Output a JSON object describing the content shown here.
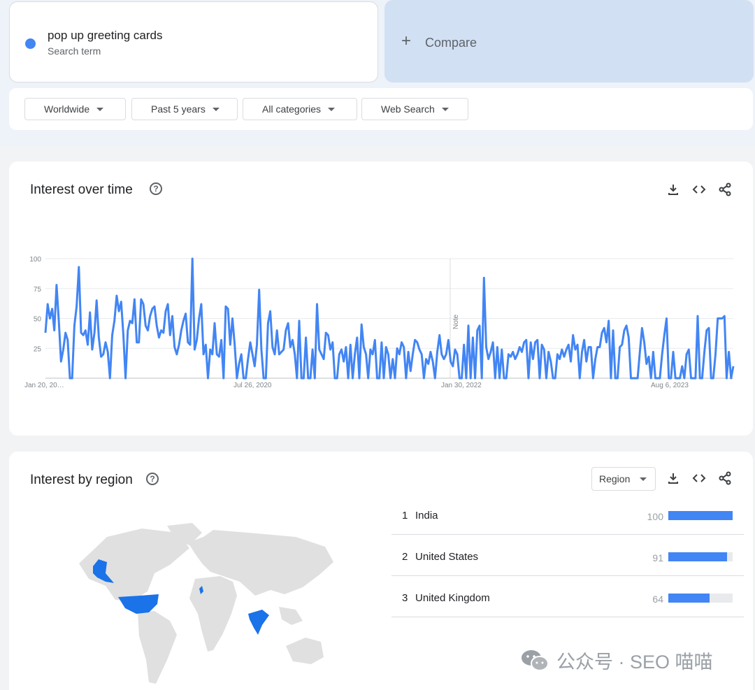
{
  "search": {
    "term": "pop up greeting cards",
    "term_type": "Search term",
    "compare_label": "Compare",
    "series_color": "#4285f4"
  },
  "filters": [
    {
      "label": "Worldwide"
    },
    {
      "label": "Past 5 years"
    },
    {
      "label": "All categories"
    },
    {
      "label": "Web Search"
    }
  ],
  "interest_over_time": {
    "title": "Interest over time",
    "note_label": "Note"
  },
  "chart_data": {
    "type": "line",
    "title": "Interest over time",
    "ylim": [
      0,
      100
    ],
    "yticks": [
      25,
      50,
      75,
      100
    ],
    "xtick_labels": [
      "Jan 20, 20…",
      "Jul 26, 2020",
      "Jan 30, 2022",
      "Aug 6, 2023"
    ],
    "grid": true,
    "series": [
      {
        "name": "pop up greeting cards",
        "values": [
          38,
          62,
          50,
          58,
          40,
          78,
          48,
          14,
          24,
          38,
          32,
          0,
          0,
          44,
          60,
          93,
          38,
          36,
          40,
          28,
          55,
          24,
          38,
          65,
          34,
          18,
          20,
          30,
          22,
          0,
          36,
          48,
          69,
          56,
          64,
          36,
          0,
          40,
          48,
          46,
          66,
          30,
          30,
          66,
          62,
          44,
          40,
          52,
          58,
          60,
          44,
          34,
          40,
          38,
          56,
          62,
          36,
          52,
          26,
          20,
          28,
          40,
          48,
          54,
          30,
          28,
          100,
          24,
          32,
          50,
          62,
          20,
          28,
          0,
          24,
          20,
          46,
          20,
          18,
          32,
          0,
          60,
          58,
          28,
          50,
          28,
          0,
          12,
          20,
          0,
          0,
          16,
          30,
          20,
          10,
          28,
          74,
          24,
          0,
          0,
          46,
          56,
          26,
          20,
          40,
          20,
          22,
          24,
          40,
          46,
          26,
          32,
          20,
          0,
          48,
          0,
          0,
          34,
          0,
          0,
          24,
          0,
          62,
          24,
          20,
          16,
          38,
          36,
          24,
          30,
          0,
          0,
          20,
          24,
          14,
          26,
          0,
          28,
          0,
          20,
          34,
          0,
          45,
          26,
          20,
          0,
          24,
          20,
          32,
          0,
          0,
          30,
          0,
          26,
          20,
          0,
          16,
          0,
          25,
          20,
          30,
          26,
          0,
          22,
          6,
          20,
          32,
          30,
          24,
          20,
          0,
          16,
          12,
          22,
          14,
          0,
          22,
          36,
          20,
          16,
          20,
          32,
          14,
          10,
          24,
          20,
          0,
          0,
          28,
          0,
          44,
          0,
          34,
          0,
          40,
          44,
          0,
          84,
          26,
          16,
          22,
          30,
          0,
          26,
          0,
          24,
          0,
          0,
          20,
          18,
          22,
          16,
          20,
          26,
          22,
          30,
          32,
          0,
          30,
          16,
          30,
          32,
          0,
          28,
          24,
          0,
          22,
          14,
          0,
          0,
          20,
          16,
          24,
          18,
          24,
          28,
          14,
          36,
          24,
          28,
          0,
          22,
          32,
          14,
          26,
          26,
          0,
          16,
          26,
          26,
          38,
          42,
          30,
          48,
          0,
          40,
          0,
          0,
          26,
          28,
          40,
          44,
          34,
          0,
          0,
          0,
          0,
          22,
          42,
          30,
          12,
          18,
          0,
          22,
          0,
          0,
          0,
          20,
          36,
          50,
          0,
          0,
          22,
          0,
          0,
          0,
          10,
          0,
          20,
          24,
          0,
          0,
          0,
          52,
          0,
          0,
          22,
          40,
          42,
          0,
          0,
          20,
          50,
          50,
          50,
          52,
          0,
          22,
          0,
          10
        ]
      }
    ]
  },
  "interest_by_region": {
    "title": "Interest by region",
    "select_label": "Region",
    "rows": [
      {
        "rank": "1",
        "name": "India",
        "value": 100
      },
      {
        "rank": "2",
        "name": "United States",
        "value": 91
      },
      {
        "rank": "3",
        "name": "United Kingdom",
        "value": 64
      }
    ],
    "map_highlight_color": "#1a73e8",
    "map_base_color": "#e0e0e0"
  },
  "watermark": {
    "text": "公众号 · SEO 喵喵"
  }
}
